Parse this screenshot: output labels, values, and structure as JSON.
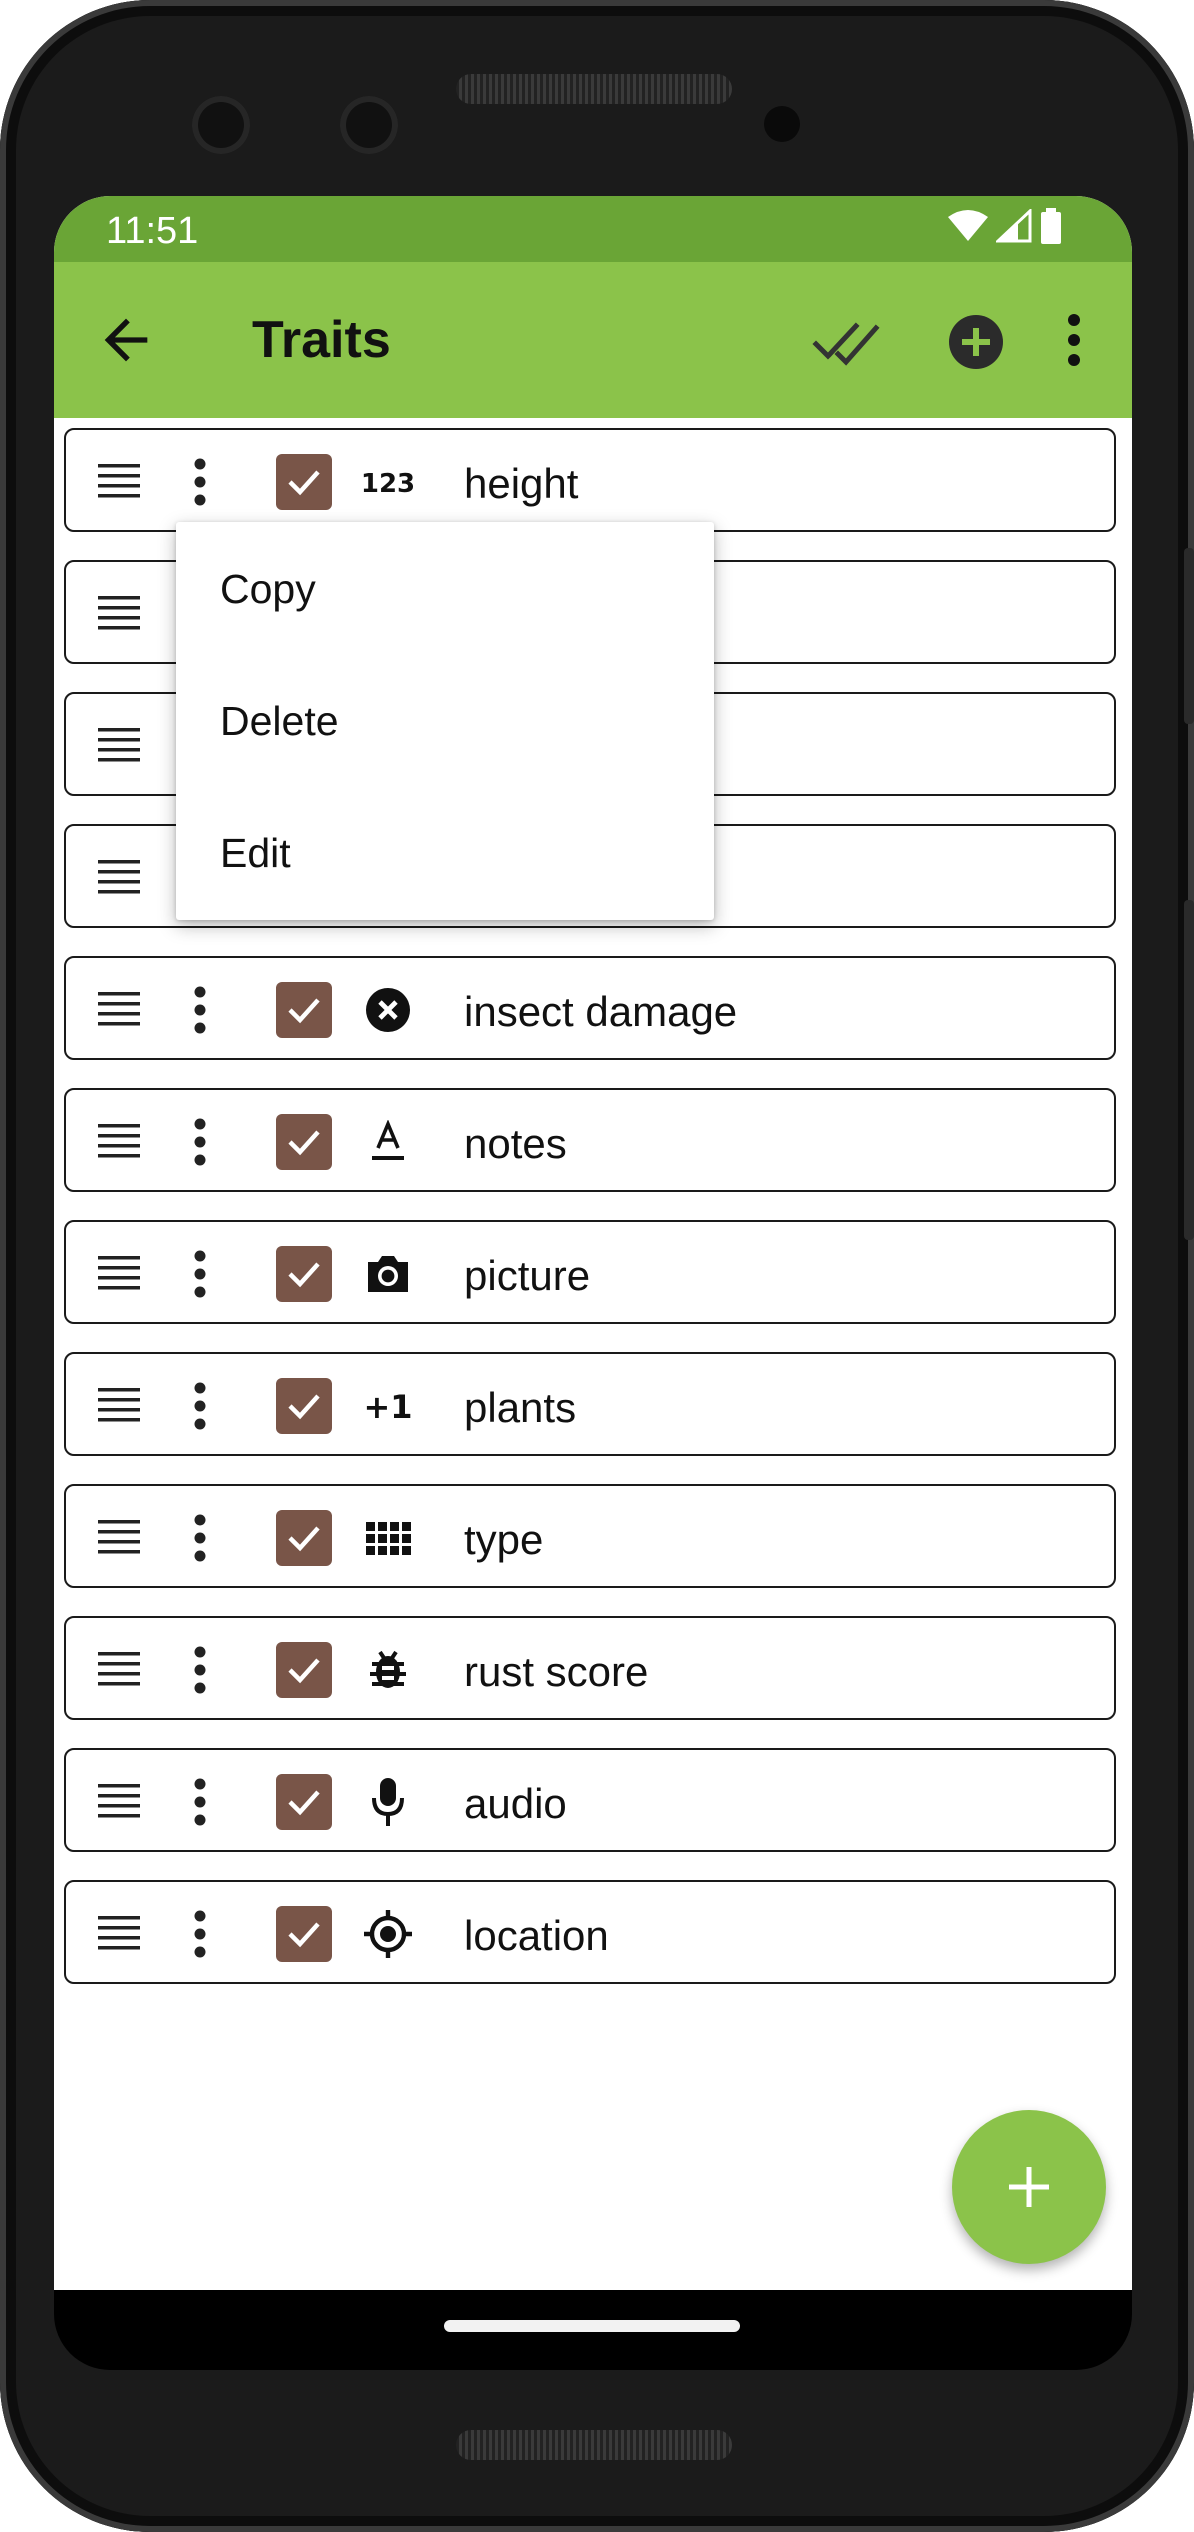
{
  "status_bar": {
    "time": "11:51"
  },
  "app_bar": {
    "title": "Traits"
  },
  "context_menu": {
    "items": [
      "Copy",
      "Delete",
      "Edit"
    ]
  },
  "traits": [
    {
      "label": "height",
      "icon": "numeric-123-icon",
      "checked": true
    },
    {
      "label": "",
      "icon": "",
      "checked": true
    },
    {
      "label": "",
      "icon": "",
      "checked": true
    },
    {
      "label": "",
      "icon": "",
      "checked": true
    },
    {
      "label": "insect damage",
      "icon": "close-circle-icon",
      "checked": true
    },
    {
      "label": "notes",
      "icon": "text-format-icon",
      "checked": true
    },
    {
      "label": "picture",
      "icon": "camera-icon",
      "checked": true
    },
    {
      "label": "plants",
      "icon": "plus-one-icon",
      "checked": true
    },
    {
      "label": "type",
      "icon": "grid-icon",
      "checked": true
    },
    {
      "label": "rust score",
      "icon": "bug-icon",
      "checked": true
    },
    {
      "label": "audio",
      "icon": "microphone-icon",
      "checked": true
    },
    {
      "label": "location",
      "icon": "crosshairs-gps-icon",
      "checked": true
    }
  ],
  "colors": {
    "app_bar": "#8bc34a",
    "status_bar": "#6aa536",
    "checkbox": "#795548",
    "fab": "#8bc34a"
  }
}
